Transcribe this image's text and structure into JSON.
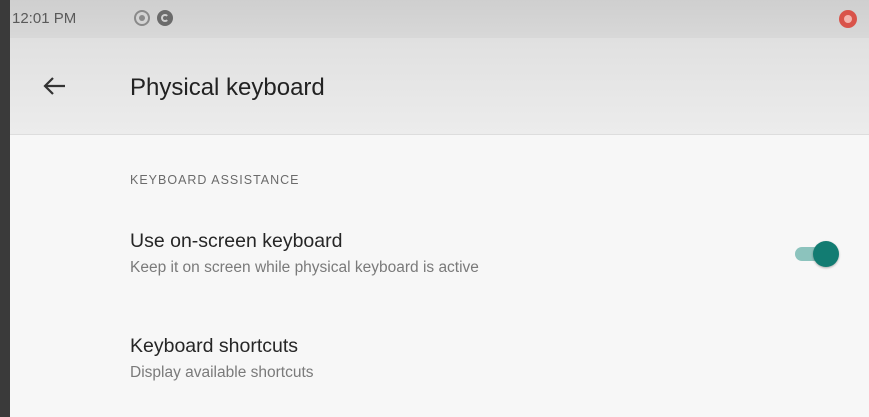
{
  "status_bar": {
    "time": "12:01 PM",
    "icons": [
      "screen-record-icon",
      "g-app-icon",
      "recording-indicator-icon"
    ]
  },
  "app_bar": {
    "back_icon": "arrow-back-icon",
    "title": "Physical keyboard"
  },
  "section": {
    "header": "KEYBOARD ASSISTANCE"
  },
  "preferences": [
    {
      "title": "Use on-screen keyboard",
      "summary": "Keep it on screen while physical keyboard is active",
      "toggle_on": true
    },
    {
      "title": "Keyboard shortcuts",
      "summary": "Display available shortcuts"
    }
  ],
  "colors": {
    "accent": "#127c72",
    "accent_track": "#8cc3bd",
    "recording": "#d9534a"
  }
}
